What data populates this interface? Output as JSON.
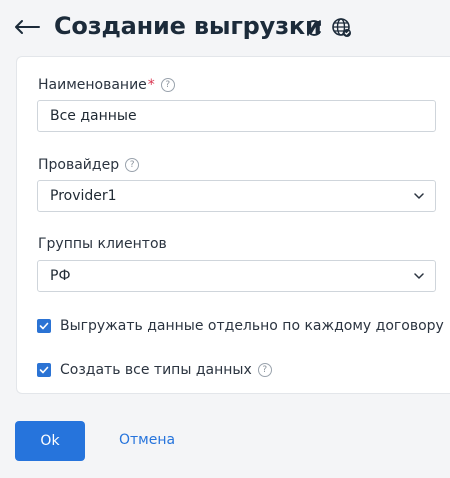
{
  "header": {
    "title": "Создание выгрузки",
    "back_icon": "arrow-left-icon",
    "refresh_icon": "refresh-icon",
    "globe_icon": "globe-icon"
  },
  "form": {
    "name": {
      "label": "Наименование",
      "required_mark": "*",
      "value": "Все данные"
    },
    "provider": {
      "label": "Провайдер",
      "selected": "Provider1"
    },
    "client_groups": {
      "label": "Группы клиентов",
      "selected": "РФ"
    },
    "checkbox_per_contract": {
      "label": "Выгружать данные отдельно по каждому договору",
      "checked": true
    },
    "checkbox_all_types": {
      "label": "Создать все типы данных",
      "checked": true
    },
    "help_glyph": "?"
  },
  "actions": {
    "ok_label": "Ok",
    "cancel_label": "Отмена"
  },
  "colors": {
    "accent": "#2674dc",
    "required": "#d9344f",
    "title": "#1c2b3a"
  }
}
